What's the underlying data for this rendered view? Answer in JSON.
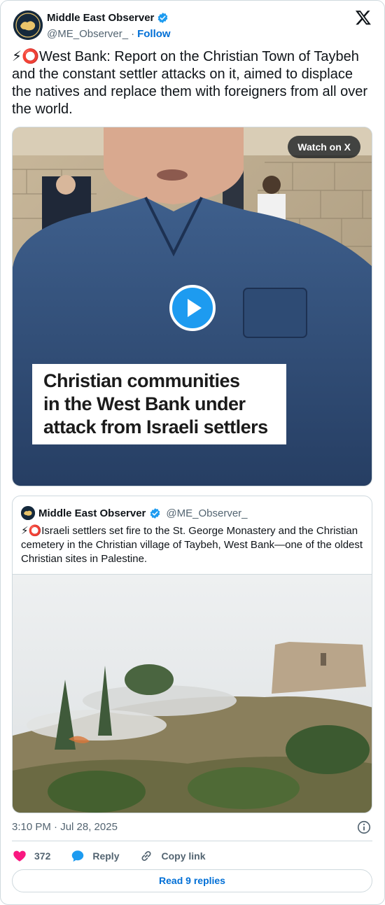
{
  "author": {
    "name": "Middle East Observer",
    "handle": "@ME_Observer_",
    "separator": "·",
    "follow_label": "Follow"
  },
  "tweet": {
    "text": "⚡⭕West Bank: Report on the Christian Town of Taybeh and the constant settler attacks on it, aimed to displace the natives and replace them with foreigners from all over the world."
  },
  "video": {
    "watch_label": "Watch on X",
    "caption_lines": [
      "Christian communities",
      "in the West Bank under",
      "attack from Israeli settlers"
    ]
  },
  "quote": {
    "name": "Middle East Observer",
    "handle": "@ME_Observer_",
    "text": "⚡⭕Israeli settlers set fire to the St. George Monastery and the Christian cemetery in the Christian village of Taybeh, West Bank—one of the oldest Christian sites in Palestine."
  },
  "footer": {
    "timestamp": "3:10 PM · Jul 28, 2025",
    "like_count": "372",
    "reply_label": "Reply",
    "copy_label": "Copy link",
    "read_replies_label": "Read 9 replies"
  },
  "colors": {
    "link_blue": "#006fd6",
    "verified_blue": "#1d9bf0",
    "like_pink": "#f91880",
    "muted": "#536471"
  },
  "icons": [
    "verified-icon",
    "x-logo-icon",
    "play-icon",
    "heart-icon",
    "reply-bubble-icon",
    "link-icon",
    "info-icon"
  ]
}
